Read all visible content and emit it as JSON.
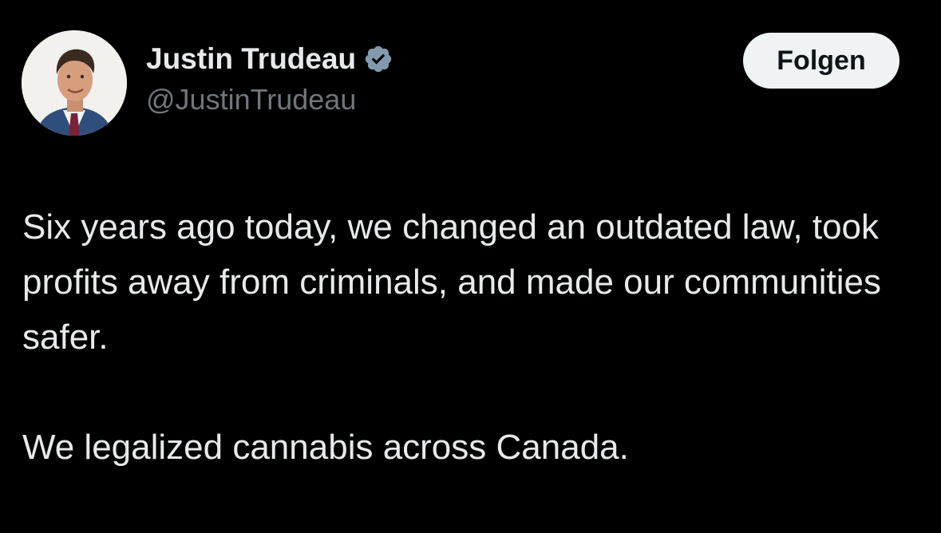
{
  "tweet": {
    "author": {
      "display_name": "Justin Trudeau",
      "handle": "@JustinTrudeau",
      "verified": true,
      "avatar_icon": "profile-photo",
      "verified_icon": "verified-badge-icon"
    },
    "follow_button_label": "Folgen",
    "text_paragraphs": [
      "Six years ago today, we changed an outdated law, took profits away from criminals, and made our communities safer.",
      "We legalized cannabis across Canada."
    ]
  },
  "colors": {
    "background": "#000000",
    "primary_text": "#e7e9ea",
    "secondary_text": "#71767b",
    "follow_button_bg": "#eff3f4",
    "follow_button_text": "#0f1419",
    "verified_badge": "#829aab"
  }
}
